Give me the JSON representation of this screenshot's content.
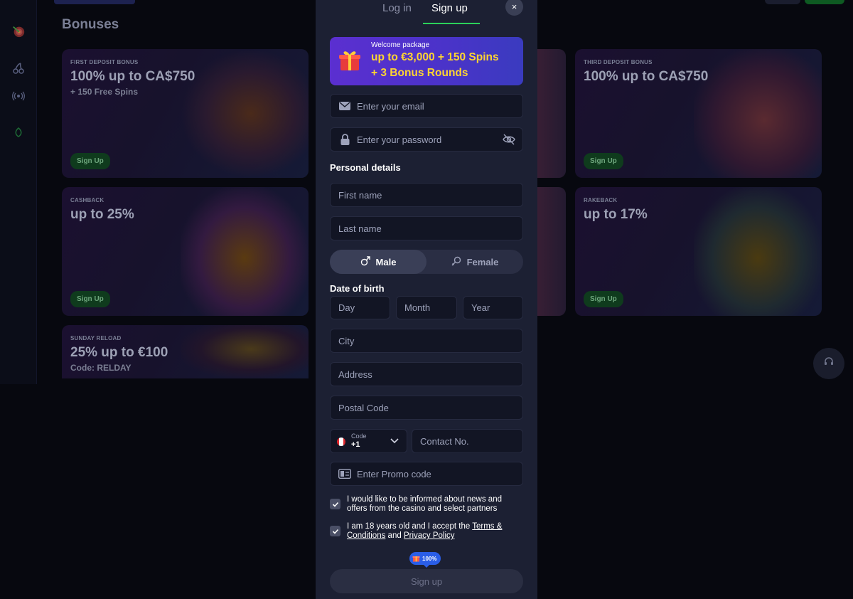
{
  "background": {
    "page_title": "Bonuses",
    "cards": [
      {
        "tag": "FIRST DEPOSIT BONUS",
        "headline": "100% up to CA$750",
        "sub": "+ 150 Free Spins",
        "button": "Sign Up"
      },
      {
        "tag": "THIRD DEPOSIT BONUS",
        "headline": "100% up to CA$750",
        "sub": "",
        "button": "Sign Up"
      },
      {
        "tag": "CASHBACK",
        "headline": "up to 25%",
        "sub": "",
        "button": "Sign Up"
      },
      {
        "tag": "RAKEBACK",
        "headline": "up to 17%",
        "sub": "",
        "button": "Sign Up"
      },
      {
        "tag": "SUNDAY RELOAD",
        "headline": "25% up to €100",
        "sub": "Code: RELDAY",
        "button": ""
      }
    ]
  },
  "modal": {
    "tabs": {
      "login": "Log in",
      "signup": "Sign up",
      "active": "signup"
    },
    "close_glyph": "×",
    "promo": {
      "kicker": "Welcome package",
      "line1": "up to €3,000 + 150 Spins",
      "line2": "+ 3 Bonus Rounds",
      "icon": "gift-icon"
    },
    "email_placeholder": "Enter your email",
    "password_placeholder": "Enter your password",
    "personal_details_label": "Personal details",
    "first_name_placeholder": "First name",
    "last_name_placeholder": "Last name",
    "gender": {
      "male": "Male",
      "female": "Female",
      "selected": "Male"
    },
    "dob_label": "Date of birth",
    "dob": {
      "day": "Day",
      "month": "Month",
      "year": "Year"
    },
    "city_placeholder": "City",
    "address_placeholder": "Address",
    "postal_code_placeholder": "Postal Code",
    "phone": {
      "code_label": "Code",
      "code_value": "+1",
      "contact_placeholder": "Contact No."
    },
    "promo_code_placeholder": "Enter Promo code",
    "consent_news": "I would like to be informed about news and offers from the casino and select partners",
    "consent_age": {
      "prefix": "I am 18 years old and I accept the",
      "terms_link": "Terms & Conditions",
      "joiner": "and",
      "privacy_link": "Privacy Policy"
    },
    "progress_badge": "100%",
    "submit_label": "Sign up",
    "colors": {
      "accent": "#2bd05a",
      "promo_text": "#ffd531",
      "promo_bg": "#4a33c9",
      "badge": "#2a5ee8"
    }
  }
}
